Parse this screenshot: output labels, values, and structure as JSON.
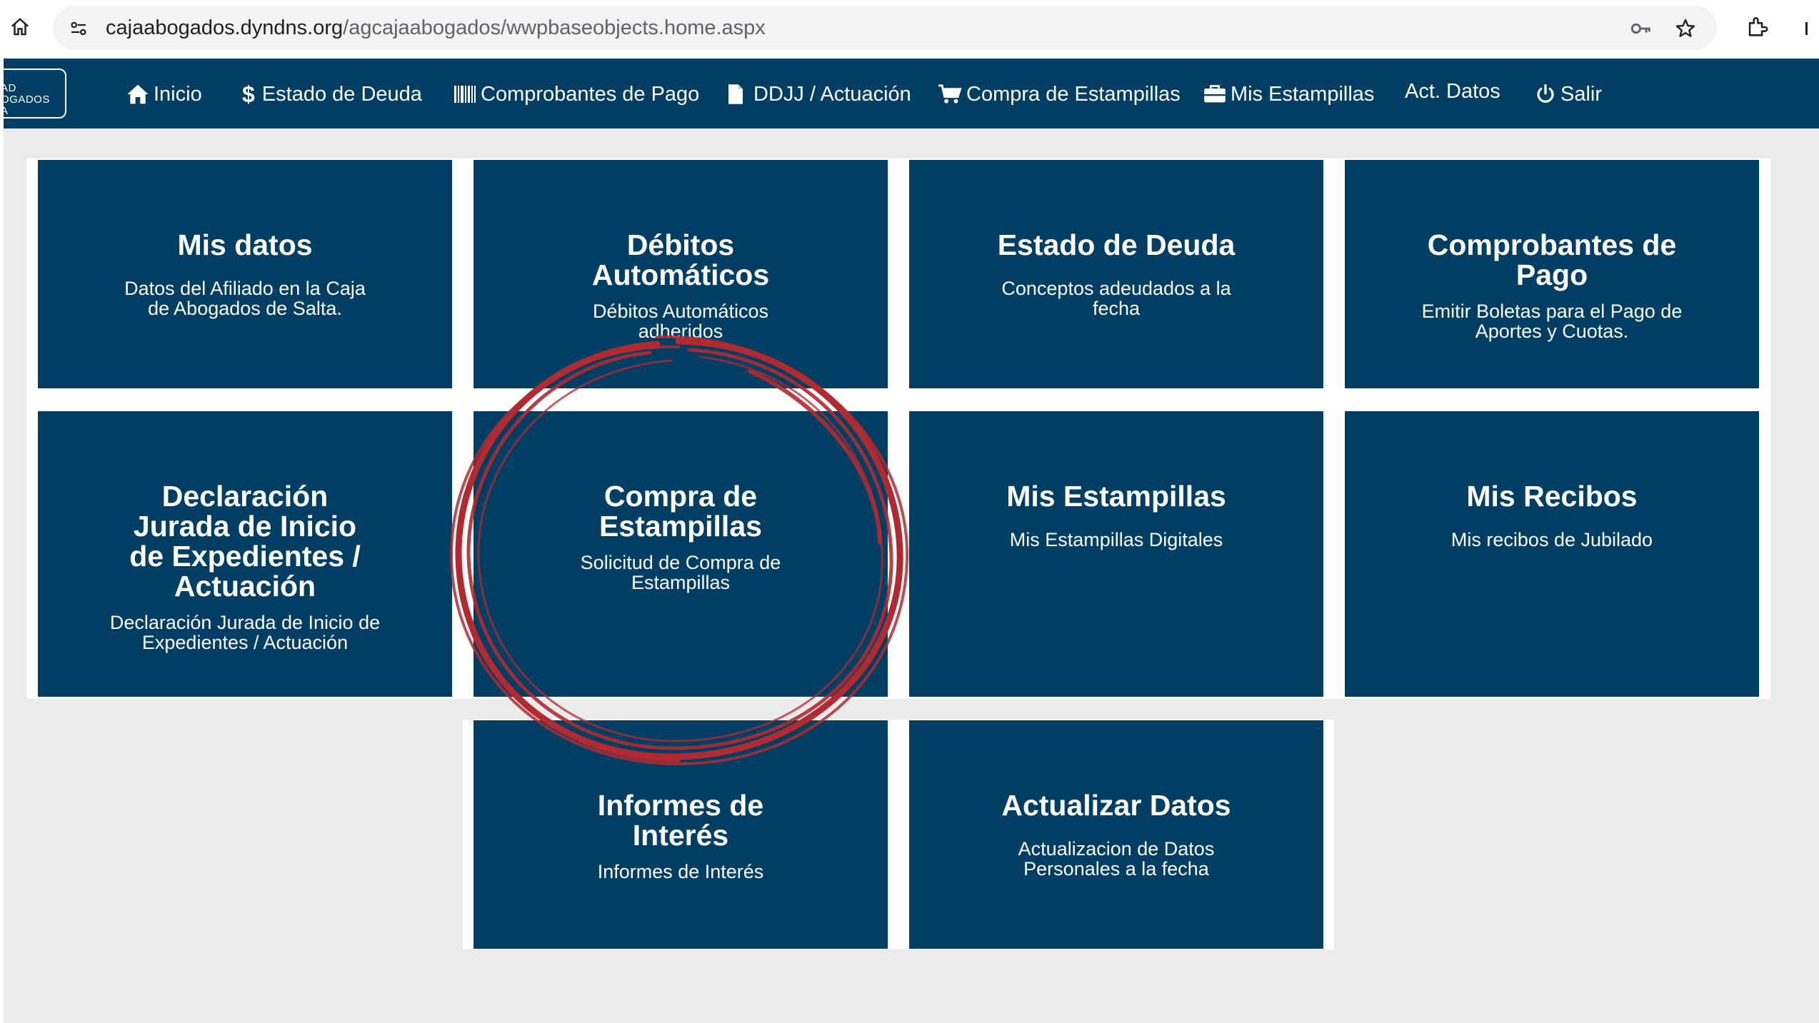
{
  "browser": {
    "url_host": "cajaabogados.dyndns.org",
    "url_path": "/agcajaabogados/wwpbaseobjects.home.aspx"
  },
  "logo": {
    "text": "AD\nOGADOS\nA"
  },
  "nav": {
    "items": [
      {
        "label": "Inicio",
        "icon": "home-icon"
      },
      {
        "label": "Estado de Deuda",
        "icon": "dollar-icon"
      },
      {
        "label": "Comprobantes de Pago",
        "icon": "barcode-icon"
      },
      {
        "label": "DDJJ / Actuación",
        "icon": "file-icon"
      },
      {
        "label": "Compra de Estampillas",
        "icon": "cart-icon"
      },
      {
        "label": "Mis Estampillas",
        "icon": "briefcase-icon"
      },
      {
        "label": "Act. Datos",
        "icon": ""
      },
      {
        "label": "Salir",
        "icon": "power-icon"
      }
    ]
  },
  "tiles": [
    {
      "title": "Mis datos",
      "desc": "Datos del Afiliado en la Caja de Abogados de Salta."
    },
    {
      "title": "Débitos Automáticos",
      "desc": "Débitos Automáticos adheridos"
    },
    {
      "title": "Estado de Deuda",
      "desc": "Conceptos adeudados a la fecha"
    },
    {
      "title": "Comprobantes de Pago",
      "desc": "Emitir Boletas para el Pago de Aportes y Cuotas."
    },
    {
      "title": "Declaración Jurada de Inicio de Expedientes / Actuación",
      "desc": "Declaración Jurada de Inicio de Expedientes / Actuación"
    },
    {
      "title": "Compra de Estampillas",
      "desc": "Solicitud de Compra de Estampillas"
    },
    {
      "title": "Mis Estampillas",
      "desc": "Mis Estampillas Digitales"
    },
    {
      "title": "Mis Recibos",
      "desc": "Mis recibos de Jubilado"
    },
    {
      "title": "Informes de Interés",
      "desc": "Informes de Interés"
    },
    {
      "title": "Actualizar Datos",
      "desc": "Actualizacion de Datos Personales a la fecha"
    }
  ],
  "colors": {
    "nav_bg": "#003f63",
    "tile_bg": "#003f63",
    "annotation": "#b02a30"
  }
}
